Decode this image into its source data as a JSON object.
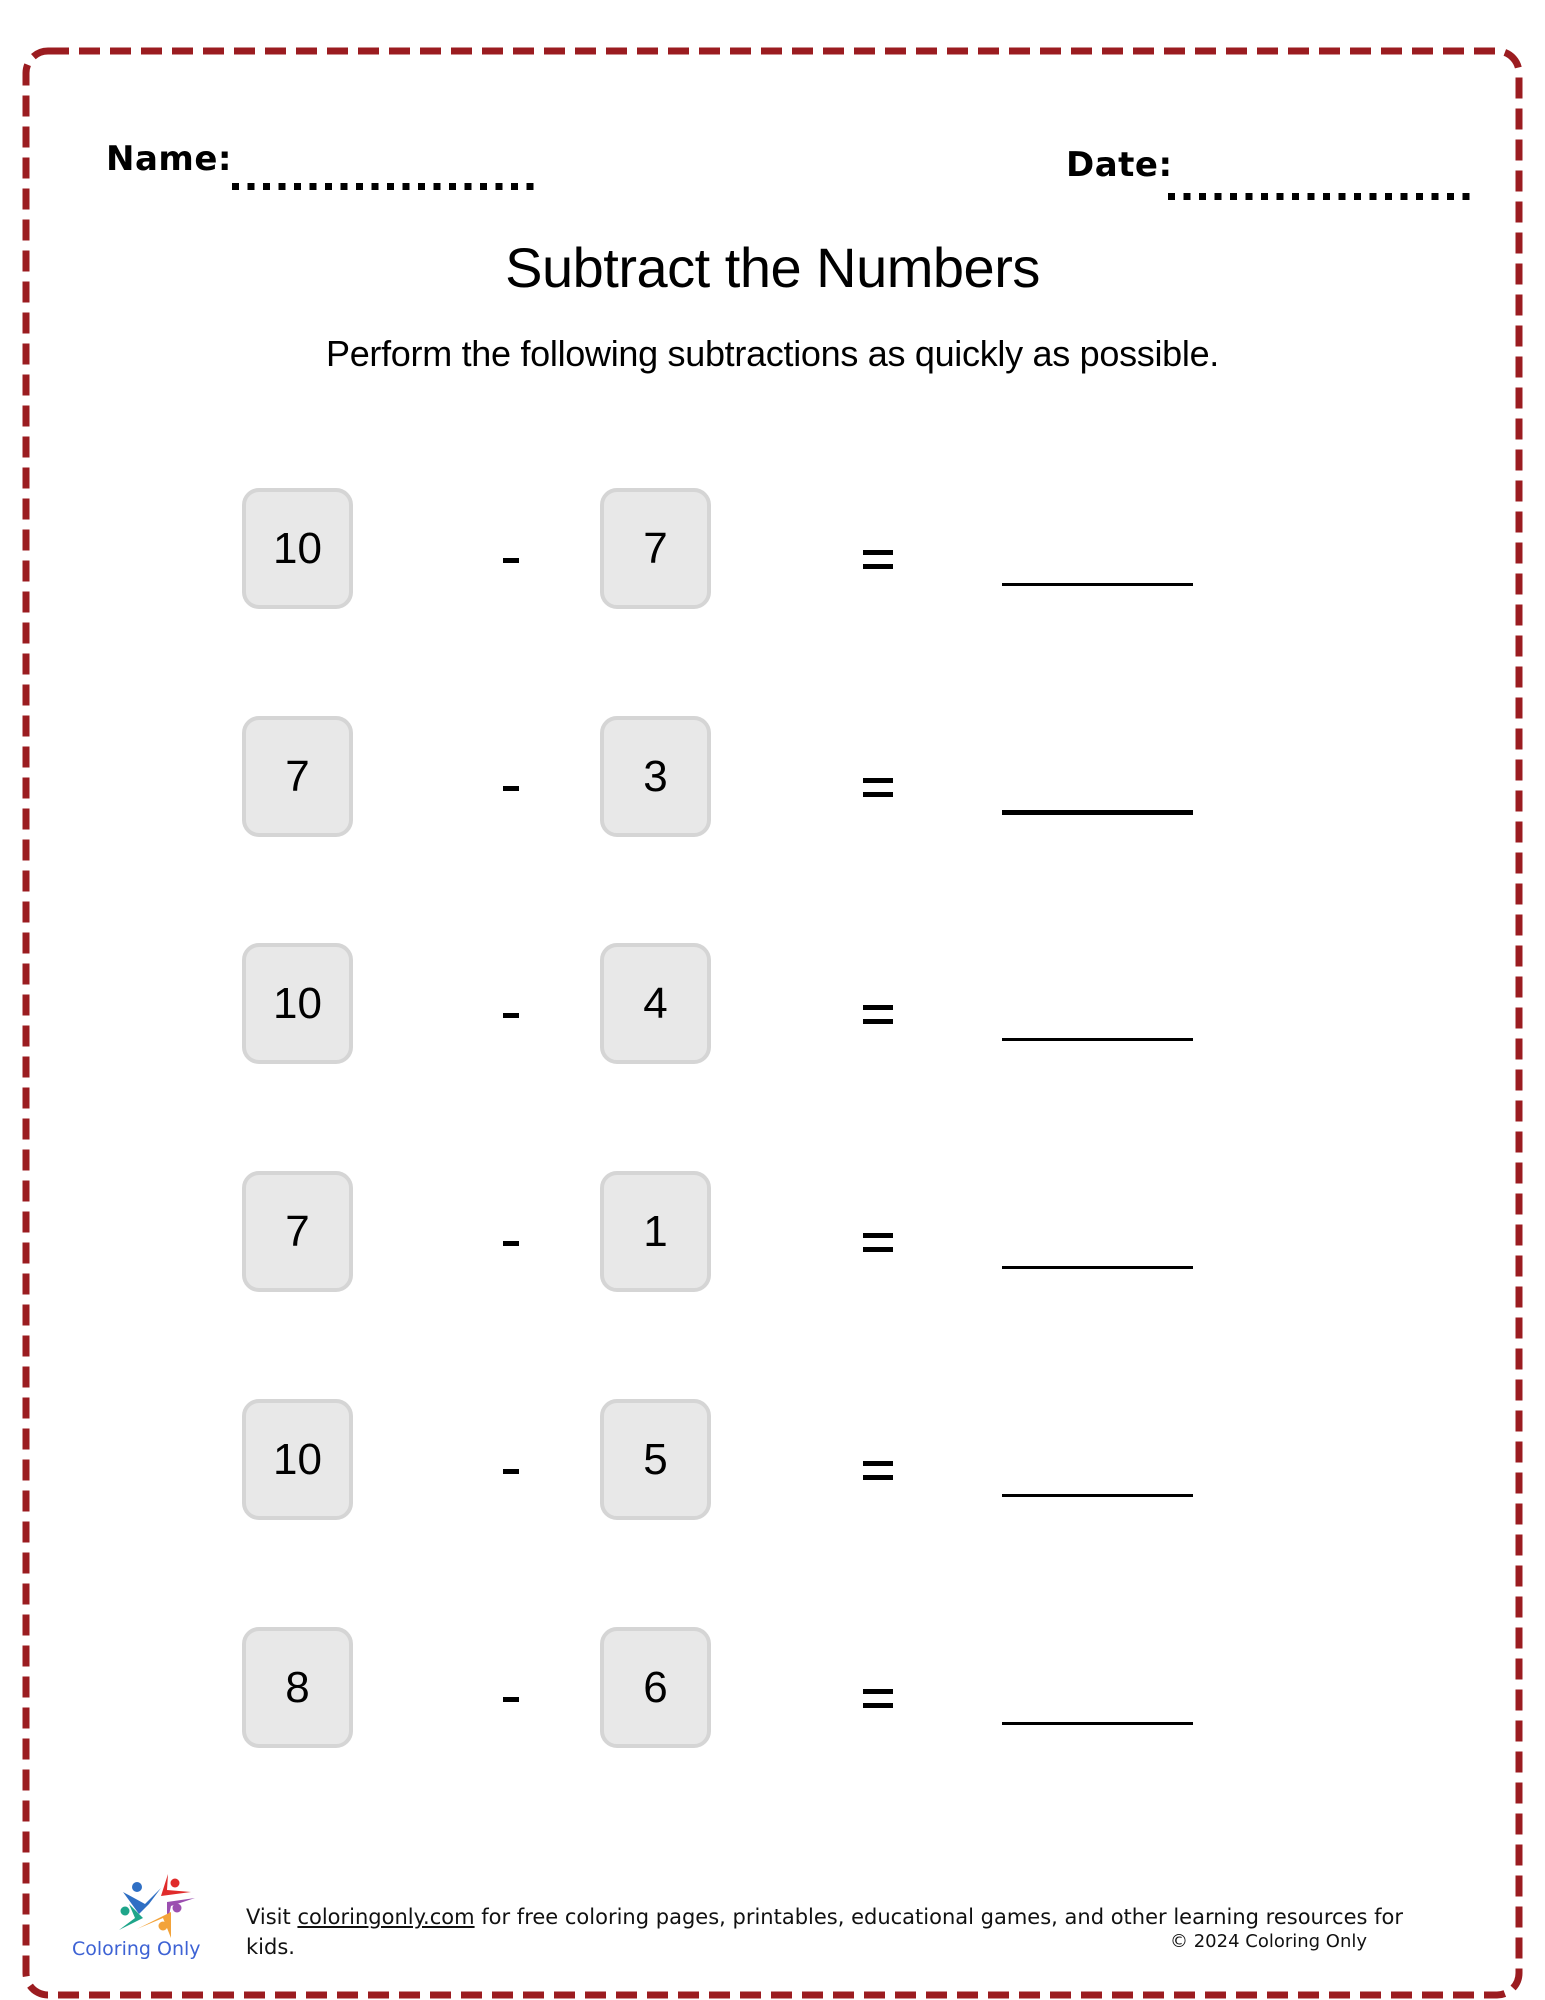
{
  "worksheet": {
    "name_label": "Name:",
    "date_label": "Date:",
    "title": "Subtract the Numbers",
    "instructions": "Perform the following subtractions as quickly as possible.",
    "operator": "-",
    "equals": "=",
    "border_color": "#9b1c20",
    "box_fill": "#e8e8e8",
    "box_border": "#d5d5d5",
    "problems": [
      {
        "minuend": "10",
        "subtrahend": "7"
      },
      {
        "minuend": "7",
        "subtrahend": "3"
      },
      {
        "minuend": "10",
        "subtrahend": "4"
      },
      {
        "minuend": "7",
        "subtrahend": "1"
      },
      {
        "minuend": "10",
        "subtrahend": "5"
      },
      {
        "minuend": "8",
        "subtrahend": "6"
      }
    ]
  },
  "footer": {
    "logo_icon": "coloring-only-star-people-logo",
    "logo_text": "Coloring Only",
    "visit_prefix": "Visit ",
    "link_text": "coloringonly.com",
    "visit_suffix": " for free coloring pages, printables, educational games, and other learning resources for kids.",
    "copyright": "© 2024 Coloring Only",
    "logo_text_color": "#3d62d4"
  }
}
